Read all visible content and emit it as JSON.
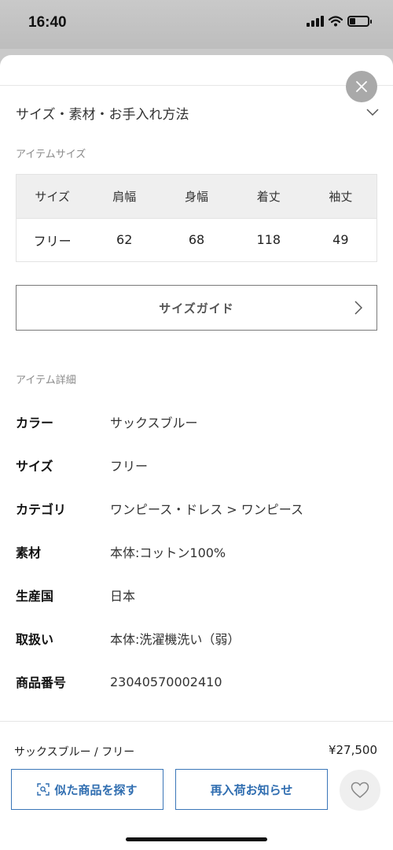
{
  "status_bar": {
    "time": "16:40"
  },
  "section": {
    "title": "サイズ・素材・お手入れ方法"
  },
  "item_size": {
    "label": "アイテムサイズ",
    "headers": [
      "サイズ",
      "肩幅",
      "身幅",
      "着丈",
      "袖丈"
    ],
    "row": [
      "フリー",
      "62",
      "68",
      "118",
      "49"
    ]
  },
  "size_guide": {
    "label": "サイズガイド"
  },
  "item_details": {
    "label": "アイテム詳細",
    "rows": [
      {
        "key": "カラー",
        "value": "サックスブルー"
      },
      {
        "key": "サイズ",
        "value": "フリー"
      },
      {
        "key": "カテゴリ",
        "value": "ワンピース・ドレス > ワンピース"
      },
      {
        "key": "素材",
        "value": "本体:コットン100%"
      },
      {
        "key": "生産国",
        "value": "日本"
      },
      {
        "key": "取扱い",
        "value": "本体:洗濯機洗い（弱）"
      },
      {
        "key": "商品番号",
        "value": "23040570002410"
      }
    ]
  },
  "footer": {
    "variant": "サックスブルー / フリー",
    "price": "¥27,500",
    "similar_button": "似た商品を探す",
    "restock_button": "再入荷お知らせ"
  },
  "colors": {
    "accent": "#2f6db0",
    "close_bg": "#a9a9a9"
  },
  "icons": [
    "close-icon",
    "chevron-down-icon",
    "chevron-right-icon",
    "image-search-icon",
    "heart-icon",
    "signal-icon",
    "wifi-icon",
    "battery-icon"
  ]
}
